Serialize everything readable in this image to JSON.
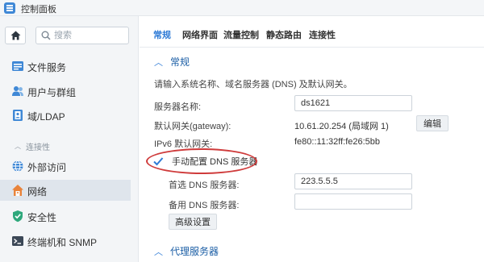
{
  "window": {
    "title": "控制面板"
  },
  "sidebar": {
    "search_placeholder": "搜索",
    "items": [
      {
        "label": "文件服务",
        "icon": "folder-icon"
      },
      {
        "label": "用户与群组",
        "icon": "users-icon"
      },
      {
        "label": "域/LDAP",
        "icon": "directory-icon"
      },
      {
        "label": "外部访问",
        "icon": "globe-icon"
      },
      {
        "label": "网络",
        "icon": "network-home-icon",
        "active": true
      },
      {
        "label": "安全性",
        "icon": "shield-icon"
      },
      {
        "label": "终端机和 SNMP",
        "icon": "terminal-icon"
      }
    ],
    "group_label": "连接性"
  },
  "tabs": [
    "常规",
    "网络界面",
    "流量控制",
    "静态路由",
    "连接性"
  ],
  "active_tab": 0,
  "general": {
    "section_title": "常规",
    "description": "请输入系统名称、域名服务器 (DNS) 及默认网关。",
    "server_name_label": "服务器名称:",
    "server_name_value": "ds1621",
    "gateway_label": "默认网关(gateway):",
    "gateway_value": "10.61.20.254 (局域网 1)",
    "edit_label": "编辑",
    "ipv6_gateway_label": "IPv6 默认网关:",
    "ipv6_gateway_value": "fe80::11:32ff:fe26:5bb",
    "manual_dns_label": "手动配置 DNS 服务器",
    "manual_dns_checked": true,
    "primary_dns_label": "首选 DNS 服务器:",
    "primary_dns_value": "223.5.5.5",
    "secondary_dns_label": "备用 DNS 服务器:",
    "secondary_dns_value": "",
    "advanced_label": "高级设置"
  },
  "proxy": {
    "section_title": "代理服务器"
  },
  "colors": {
    "accent": "#2f7bd6",
    "highlight_ellipse": "#cf3b3b",
    "sidebar_active": "#dfe5ec"
  }
}
